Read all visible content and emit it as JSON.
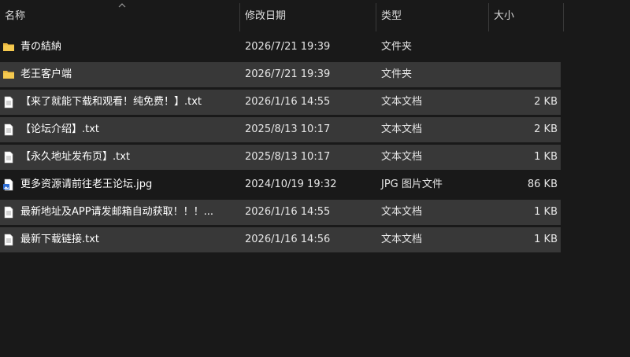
{
  "columns": {
    "name": "名称",
    "date": "修改日期",
    "type": "类型",
    "size": "大小"
  },
  "files": [
    {
      "name": "青の結納",
      "date": "2026/7/21 19:39",
      "type": "文件夹",
      "size": "",
      "icon": "folder-icon"
    },
    {
      "name": "老王客户端",
      "date": "2026/7/21 19:39",
      "type": "文件夹",
      "size": "",
      "icon": "folder-icon"
    },
    {
      "name": "【来了就能下载和观看！纯免费！】.txt",
      "date": "2026/1/16 14:55",
      "type": "文本文档",
      "size": "2 KB",
      "icon": "text-file-icon"
    },
    {
      "name": "【论坛介绍】.txt",
      "date": "2025/8/13 10:17",
      "type": "文本文档",
      "size": "2 KB",
      "icon": "text-file-icon"
    },
    {
      "name": "【永久地址发布页】.txt",
      "date": "2025/8/13 10:17",
      "type": "文本文档",
      "size": "1 KB",
      "icon": "text-file-icon"
    },
    {
      "name": "更多资源请前往老王论坛.jpg",
      "date": "2024/10/19 19:32",
      "type": "JPG 图片文件",
      "size": "86 KB",
      "icon": "image-file-icon"
    },
    {
      "name": "最新地址及APP请发邮箱自动获取！！！...",
      "date": "2026/1/16 14:55",
      "type": "文本文档",
      "size": "1 KB",
      "icon": "text-file-icon"
    },
    {
      "name": "最新下载链接.txt",
      "date": "2026/1/16 14:56",
      "type": "文本文档",
      "size": "1 KB",
      "icon": "text-file-icon"
    }
  ]
}
